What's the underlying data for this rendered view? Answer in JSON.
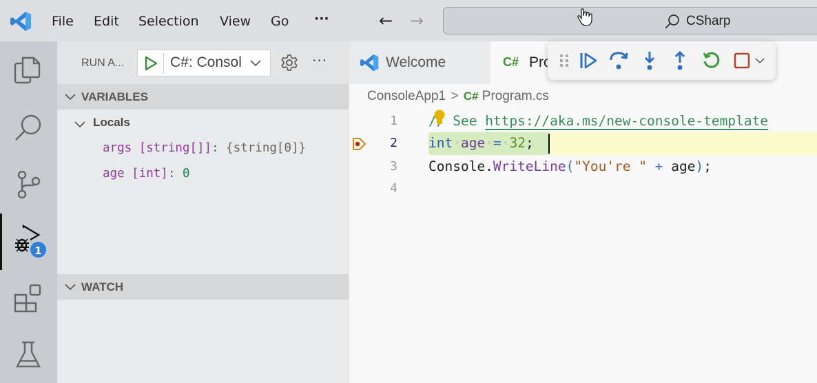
{
  "titlebar": {
    "menu": [
      "File",
      "Edit",
      "Selection",
      "View",
      "Go",
      "···"
    ],
    "nav": {
      "back": "←",
      "forward": "→"
    },
    "command_center": "CSharp"
  },
  "activity_bar": {
    "items": [
      {
        "name": "explorer",
        "icon": "files-icon"
      },
      {
        "name": "search",
        "icon": "search-icon"
      },
      {
        "name": "source-control",
        "icon": "source-control-icon"
      },
      {
        "name": "run-and-debug",
        "icon": "run-debug-icon",
        "active": true,
        "badge": "1"
      },
      {
        "name": "extensions",
        "icon": "extensions-icon"
      },
      {
        "name": "testing",
        "icon": "beaker-icon"
      }
    ],
    "badge": "1"
  },
  "sidebar": {
    "title": "RUN A...",
    "config": "C#: Consol",
    "more": "···",
    "variables": {
      "title": "VARIABLES",
      "scope": "Locals",
      "items": [
        {
          "name": "args",
          "type": "[string[]]",
          "sep": ":",
          "value": "{string[0]}"
        },
        {
          "name": "age",
          "type": "[int]",
          "sep": ":",
          "value": "0"
        }
      ]
    },
    "watch": {
      "title": "WATCH"
    }
  },
  "tabs": [
    {
      "label": "Welcome",
      "icon": "vscode-icon"
    },
    {
      "label": "Pro",
      "icon": "csharp-icon",
      "icon_text": "C#",
      "active": true
    }
  ],
  "debug_toolbar": {
    "buttons": [
      "continue",
      "step-over",
      "step-into",
      "step-out",
      "restart",
      "stop"
    ],
    "colors": {
      "blue": "#2f6fbf",
      "green": "#3a9a3a",
      "red": "#a8482a"
    }
  },
  "breadcrumb": {
    "folder": "ConsoleApp1",
    "separator": ">",
    "file_icon": "C#",
    "file": "Program.cs"
  },
  "editor": {
    "lines": [
      {
        "number": "1",
        "comment_prefix": "//",
        "comment_text": " See ",
        "link": "https://aka.ms/new-console-template"
      },
      {
        "number": "2",
        "tokens": {
          "kw": "int",
          "dot1": "·",
          "var": "age",
          "dot2": "·",
          "op": "=",
          "dot3": "·",
          "num": "32",
          "end": ";"
        }
      },
      {
        "number": "3",
        "tokens": {
          "obj": "Console.",
          "fn": "WriteLine",
          "p1": "(",
          "str": "\"You're \"",
          "sp1": " ",
          "op": "+",
          "sp2": " ",
          "var": "age",
          "p2": ")",
          "end": ";"
        }
      },
      {
        "number": "4"
      }
    ],
    "current_line": 2
  }
}
